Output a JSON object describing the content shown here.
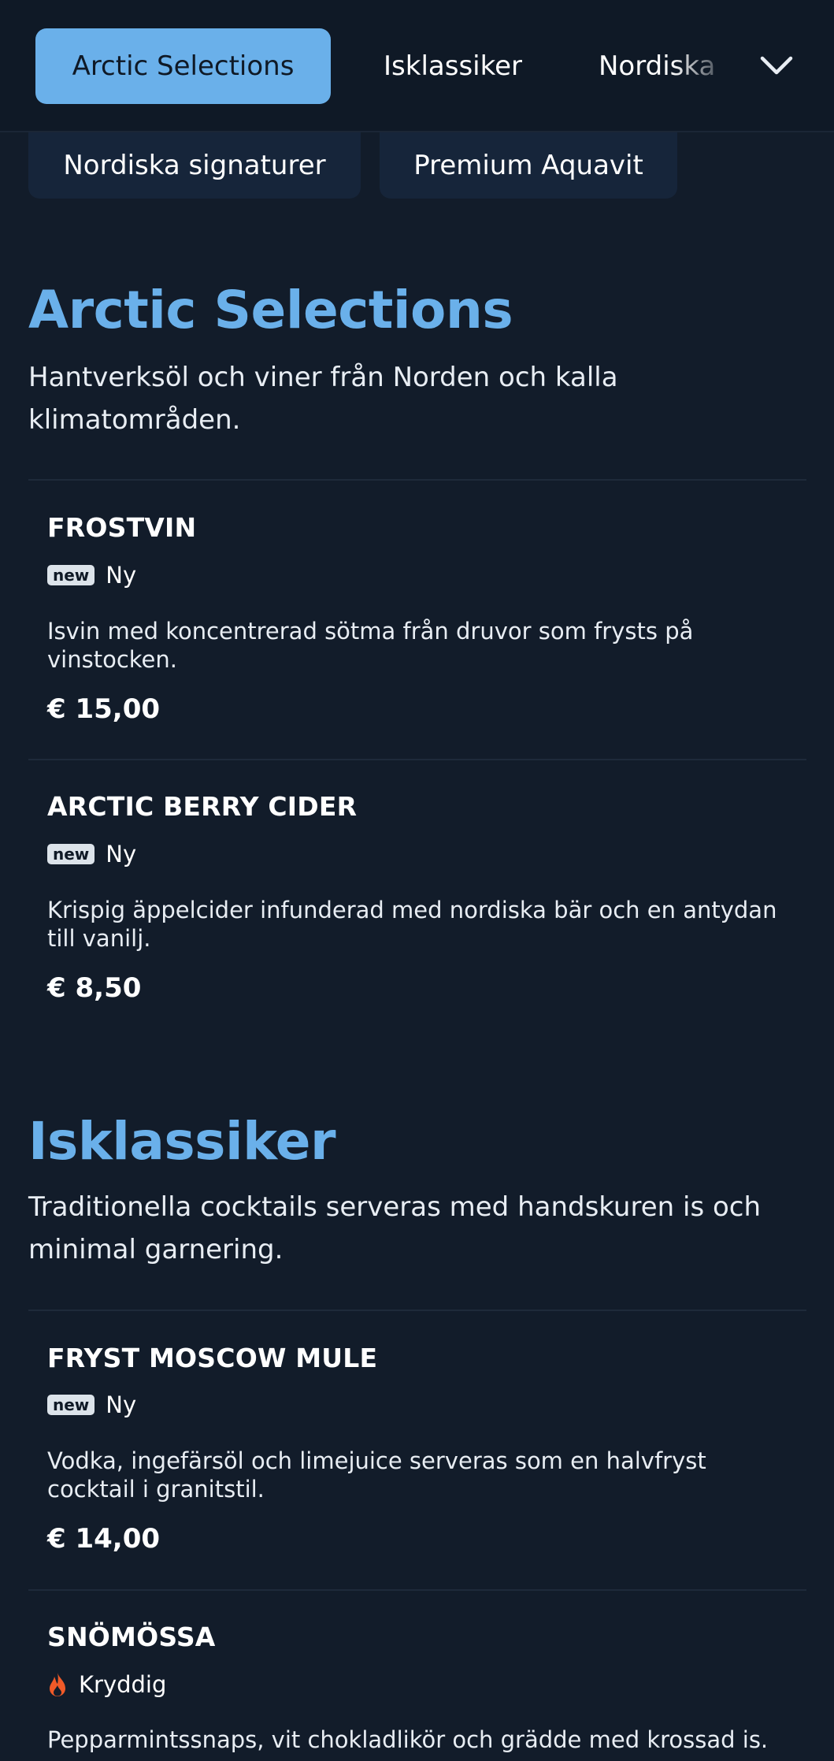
{
  "nav": {
    "tabs": [
      "Arctic Selections",
      "Isklassiker",
      "Nordiska"
    ],
    "active_tab": "Arctic Selections",
    "dropdown_icon": "chevron-down-icon"
  },
  "overflow_tabs": [
    "Nordiska signaturer",
    "Premium Aquavit"
  ],
  "colors": {
    "background": "#121c2a",
    "accent": "#6ab0ea",
    "surface": "#16253a",
    "text": "#ffffff",
    "flame": "#f05a28"
  },
  "sections": [
    {
      "title": "Arctic Selections",
      "description": "Hantverksöl och viner från Norden och kalla klimatområden.",
      "items": [
        {
          "name": "FROSTVIN",
          "badge": "new",
          "tag": "Ny",
          "description": "Isvin med koncentrerad sötma från druvor som frysts på vinstocken.",
          "price": "€ 15,00"
        },
        {
          "name": "ARCTIC BERRY CIDER",
          "badge": "new",
          "tag": "Ny",
          "description": "Krispig äppelcider infunderad med nordiska bär och en antydan till vanilj.",
          "price": "€ 8,50"
        }
      ]
    },
    {
      "title": "Isklassiker",
      "description": "Traditionella cocktails serveras med handskuren is och minimal garnering.",
      "items": [
        {
          "name": "FRYST MOSCOW MULE",
          "badge": "new",
          "tag": "Ny",
          "description": "Vodka, ingefärsöl och limejuice serveras som en halvfryst cocktail i granitstil.",
          "price": "€ 14,00"
        },
        {
          "name": "SNÖMÖSSA",
          "tag_icon": "flame-icon",
          "tag": "Kryddig",
          "description": "Pepparmintssnaps, vit chokladlikör och grädde med krossad is."
        }
      ]
    }
  ]
}
